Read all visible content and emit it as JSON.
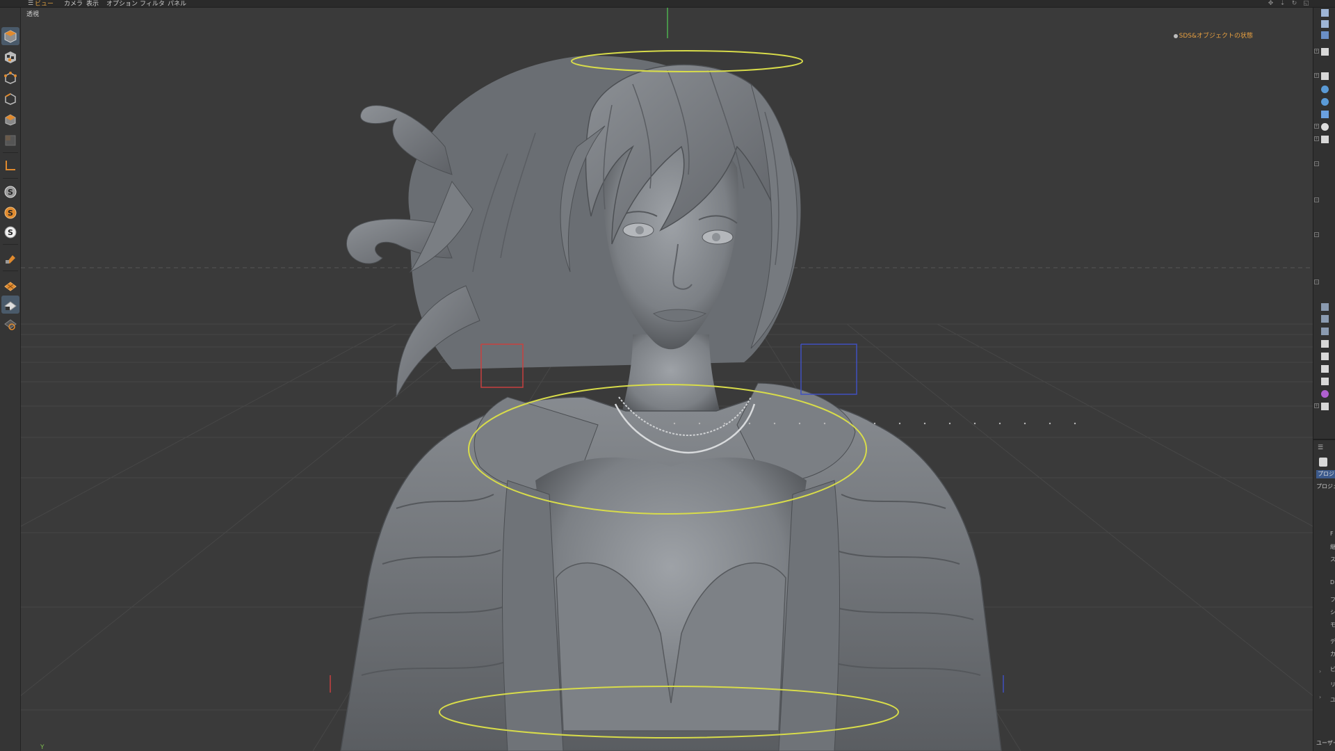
{
  "menubar": {
    "items": [
      "ビュー",
      "カメラ",
      "表示",
      "オプション",
      "フィルタ",
      "パネル"
    ],
    "active_index": 0
  },
  "viewport": {
    "label": "透視",
    "hud_status": "SDS&オブジェクトの状態",
    "axis_label": "Y",
    "colors": {
      "background": "#3a3a3a",
      "grid": "#4a4a4a",
      "highlight": "#d8dc4a",
      "model": "#8a8e93"
    }
  },
  "left_toolbar": {
    "tools": [
      {
        "name": "model-mode-icon",
        "selected": true
      },
      {
        "name": "texture-mode-icon",
        "selected": false
      },
      {
        "name": "point-mode-icon",
        "selected": false
      },
      {
        "name": "edge-mode-icon",
        "selected": false
      },
      {
        "name": "polygon-mode-icon",
        "selected": false
      },
      {
        "name": "uv-mode-icon",
        "selected": false
      },
      {
        "name": "axis-icon",
        "selected": false
      },
      {
        "name": "snap-icon",
        "selected": false
      },
      {
        "name": "snap-alt-icon",
        "selected": false
      },
      {
        "name": "snap-settings-icon",
        "selected": false
      },
      {
        "name": "magnet-icon",
        "selected": false
      },
      {
        "name": "workplane-icon",
        "selected": false
      },
      {
        "name": "grid-lock-icon",
        "selected": false
      },
      {
        "name": "workplane-settings-icon",
        "selected": false
      }
    ]
  },
  "right_panel": {
    "attr_tab": "プロジェクト",
    "attr_mode": "プロジェクト",
    "user_data": "ユーザー",
    "attr_letters": [
      "F",
      "継",
      "ス",
      "D",
      "フ",
      "シ",
      "モ",
      "デ",
      "カ",
      "ビ",
      "リ",
      "ユ"
    ]
  }
}
